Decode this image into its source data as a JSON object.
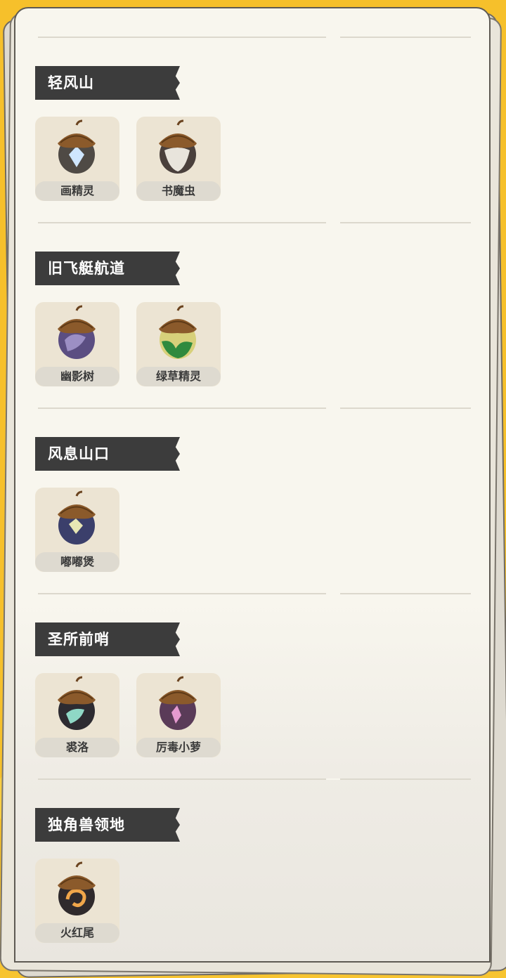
{
  "regions": [
    {
      "name": "轻风山",
      "items": [
        {
          "label": "画精灵",
          "icon": "acorn-dark-blue-gem-icon",
          "body_color": "#4f4a45",
          "gem_color": "#cfe6ff"
        },
        {
          "label": "书魔虫",
          "icon": "acorn-white-shell-icon",
          "body_color": "#4a403c",
          "gem_color": "#e8e4dc"
        }
      ]
    },
    {
      "name": "旧飞艇航道",
      "items": [
        {
          "label": "幽影树",
          "icon": "acorn-purple-icon",
          "body_color": "#5b4e82",
          "gem_color": "#9c8fc4"
        },
        {
          "label": "绿草精灵",
          "icon": "acorn-green-yellow-icon",
          "body_color": "#d7d07a",
          "gem_color": "#2f8a3e"
        }
      ]
    },
    {
      "name": "风息山口",
      "items": [
        {
          "label": "嘟嘟煲",
          "icon": "acorn-navy-diamond-icon",
          "body_color": "#3b3f6b",
          "gem_color": "#e7e6b4"
        }
      ]
    },
    {
      "name": "圣所前哨",
      "items": [
        {
          "label": "裘洛",
          "icon": "acorn-black-teal-icon",
          "body_color": "#2d2b31",
          "gem_color": "#8fd8c6"
        },
        {
          "label": "厉毒小萝",
          "icon": "acorn-magenta-icon",
          "body_color": "#5a3b58",
          "gem_color": "#e59ad0"
        }
      ]
    },
    {
      "name": "独角兽领地",
      "items": [
        {
          "label": "火红尾",
          "icon": "acorn-fire-swirl-icon",
          "body_color": "#2f2a2c",
          "gem_color": "#f0a64a"
        }
      ]
    }
  ]
}
